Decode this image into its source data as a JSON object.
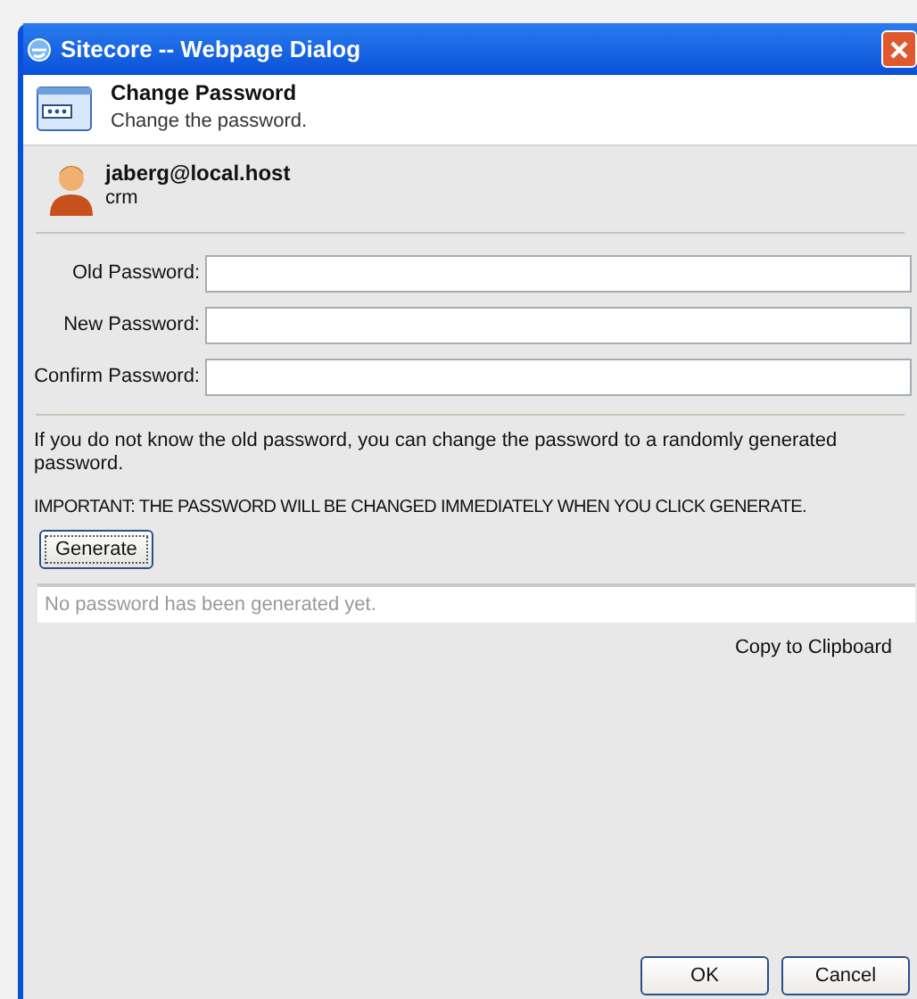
{
  "window": {
    "title": "Sitecore -- Webpage Dialog"
  },
  "header": {
    "title": "Change Password",
    "subtitle": "Change the password."
  },
  "user": {
    "name": "jaberg@local.host",
    "domain": "crm"
  },
  "fields": [
    {
      "label": "Old Password:"
    },
    {
      "label": "New Password:"
    },
    {
      "label": "Confirm Password:"
    }
  ],
  "info": "If you do not know the old password, you can change the password to a randomly generated password.",
  "warning": "IMPORTANT: THE PASSWORD WILL BE CHANGED IMMEDIATELY WHEN YOU CLICK GENERATE.",
  "generate_button": "Generate",
  "generated": {
    "placeholder": "No password has been generated yet."
  },
  "copy_link": "Copy to Clipboard",
  "buttons": [
    "OK",
    "Cancel"
  ]
}
